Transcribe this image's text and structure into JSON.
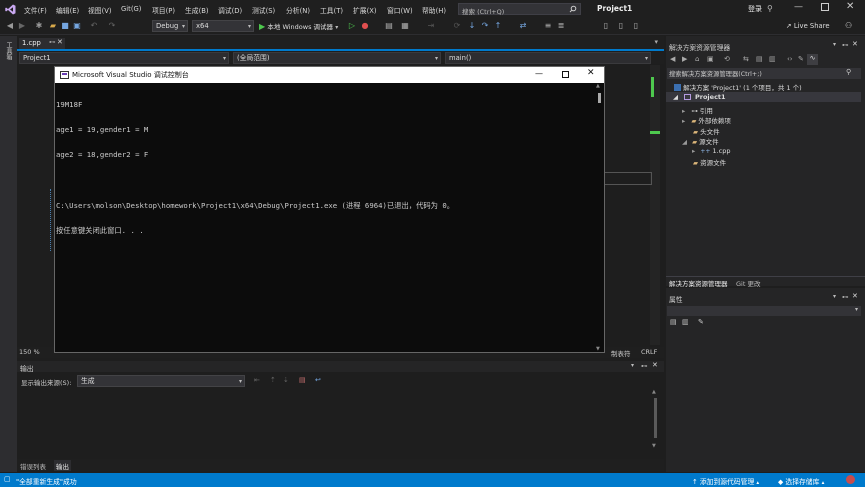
{
  "menu": [
    "文件(F)",
    "编辑(E)",
    "视图(V)",
    "Git(G)",
    "项目(P)",
    "生成(B)",
    "调试(D)",
    "测试(S)",
    "分析(N)",
    "工具(T)",
    "扩展(X)",
    "窗口(W)",
    "帮助(H)"
  ],
  "search_placeholder": "搜索 (Ctrl+Q)",
  "app_title": "Project1",
  "login": "登录",
  "live_share": "Live Share",
  "toolbar": {
    "config": "Debug",
    "platform": "x64",
    "run_label": "本地 Windows 调试器"
  },
  "editor": {
    "tab": "1.cpp",
    "nav_project": "Project1",
    "nav_scope": "(全局范围)",
    "nav_member": "main()",
    "zoom": "150 %",
    "eol": "CRLF",
    "encoding_label": "制表符",
    "side_label": "工具箱"
  },
  "console": {
    "title": "Microsoft Visual Studio 调试控制台",
    "lines": [
      "19M18F",
      "age1 = 19,gender1 = M",
      "age2 = 18,gender2 = F",
      "",
      "C:\\Users\\molson\\Desktop\\homework\\Project1\\x64\\Debug\\Project1.exe (进程 6964)已退出，代码为 0。",
      "按任意键关闭此窗口. . ."
    ]
  },
  "solution_explorer": {
    "title": "解决方案资源管理器",
    "search": "搜索解决方案资源管理器(Ctrl+;)",
    "solution": "解决方案 'Project1' (1 个项目，共 1 个)",
    "project": "Project1",
    "items": [
      "引用",
      "外部依赖项",
      "头文件",
      "源文件",
      "1.cpp",
      "资源文件"
    ],
    "tabs": [
      "解决方案资源管理器",
      "Git 更改"
    ]
  },
  "properties": {
    "title": "属性"
  },
  "output": {
    "title": "输出",
    "source_label": "显示输出来源(S):",
    "source_value": "生成",
    "tabs": [
      "错误列表",
      "输出"
    ]
  },
  "statusbar": {
    "message": "\"全部重新生成\"成功",
    "source_control": "添加到源代码管理",
    "repo": "选择存储库"
  },
  "colors": {
    "accent": "#007acc",
    "run": "#4ec94e",
    "console_bg": "#0c0c0c"
  }
}
